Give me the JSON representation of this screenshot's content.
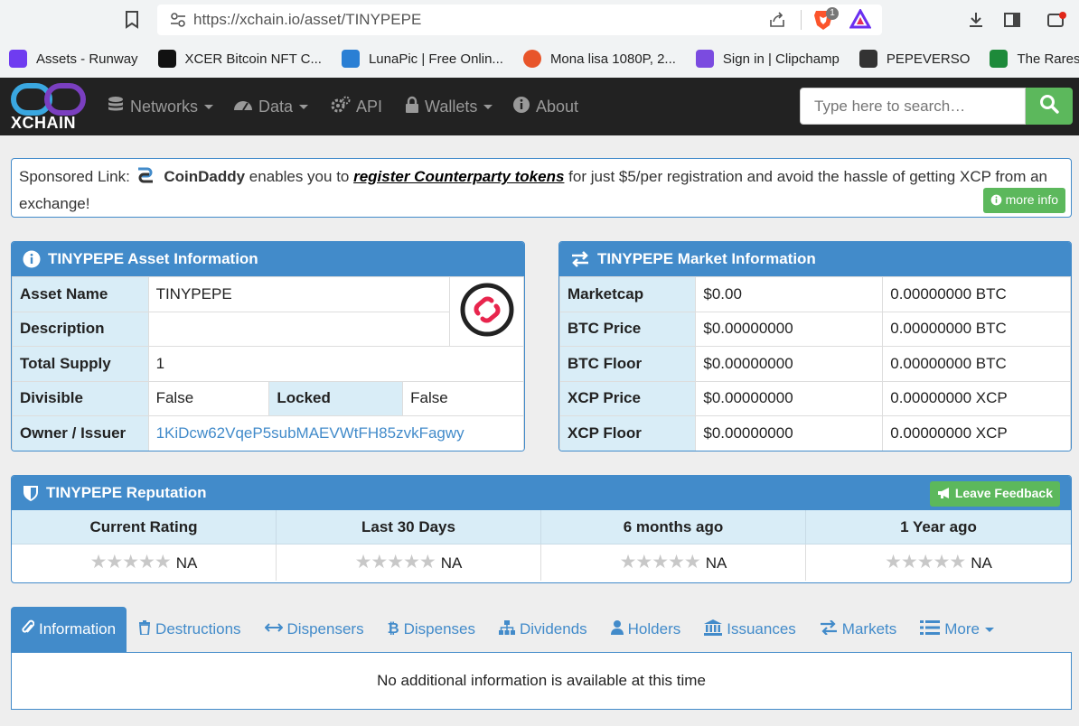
{
  "browser": {
    "url": "https://xchain.io/asset/TINYPEPE",
    "brave_badge": "1",
    "bookmarks": [
      {
        "label": "Assets - Runway",
        "color": "#6f3cf0"
      },
      {
        "label": "XCER Bitcoin NFT C...",
        "color": "#111111"
      },
      {
        "label": "LunaPic | Free Onlin...",
        "color": "#2a7fd4"
      },
      {
        "label": "Mona lisa 1080P, 2...",
        "color": "#e8552a"
      },
      {
        "label": "Sign in | Clipchamp",
        "color": "#7b4be0"
      },
      {
        "label": "PEPEVERSO",
        "color": "#333333"
      },
      {
        "label": "The Rarest Sets – T",
        "color": "#1d8a3a"
      }
    ]
  },
  "navbar": {
    "logo": "XCHAIN",
    "items": [
      {
        "label": "Networks",
        "icon": "database-icon",
        "dropdown": true
      },
      {
        "label": "Data",
        "icon": "dashboard-icon",
        "dropdown": true
      },
      {
        "label": "API",
        "icon": "cogs-icon",
        "dropdown": false
      },
      {
        "label": "Wallets",
        "icon": "lock-icon",
        "dropdown": true
      },
      {
        "label": "About",
        "icon": "info-circle-icon",
        "dropdown": false
      }
    ],
    "search_placeholder": "Type here to search…"
  },
  "sponsored": {
    "prefix": "Sponsored Link: ",
    "brand": "CoinDaddy",
    "mid": " enables you to ",
    "link": "register Counterparty tokens",
    "suffix": " for just $5/per registration and avoid the hassle of getting XCP from an exchange!",
    "more_info": "more info"
  },
  "asset_info": {
    "title": "TINYPEPE Asset Information",
    "asset_name_label": "Asset Name",
    "asset_name": "TINYPEPE",
    "description_label": "Description",
    "description": "",
    "total_supply_label": "Total Supply",
    "total_supply": "1",
    "divisible_label": "Divisible",
    "divisible": "False",
    "locked_label": "Locked",
    "locked": "False",
    "owner_label": "Owner / Issuer",
    "owner": "1KiDcw62VqeP5subMAEVWtFH85zvkFagwy"
  },
  "market_info": {
    "title": "TINYPEPE Market Information",
    "rows": [
      {
        "label": "Marketcap",
        "usd": "$0.00",
        "native": "0.00000000 BTC"
      },
      {
        "label": "BTC Price",
        "usd": "$0.00000000",
        "native": "0.00000000 BTC"
      },
      {
        "label": "BTC Floor",
        "usd": "$0.00000000",
        "native": "0.00000000 BTC"
      },
      {
        "label": "XCP Price",
        "usd": "$0.00000000",
        "native": "0.00000000 XCP"
      },
      {
        "label": "XCP Floor",
        "usd": "$0.00000000",
        "native": "0.00000000 XCP"
      }
    ]
  },
  "reputation": {
    "title": "TINYPEPE Reputation",
    "feedback_label": "Leave Feedback",
    "columns": [
      {
        "header": "Current Rating",
        "value": "NA",
        "stars": 0
      },
      {
        "header": "Last 30 Days",
        "value": "NA",
        "stars": 0
      },
      {
        "header": "6 months ago",
        "value": "NA",
        "stars": 0
      },
      {
        "header": "1 Year ago",
        "value": "NA",
        "stars": 0
      }
    ]
  },
  "tabs": [
    {
      "label": "Information",
      "icon": "paperclip-icon",
      "active": true
    },
    {
      "label": "Destructions",
      "icon": "trash-icon",
      "active": false
    },
    {
      "label": "Dispensers",
      "icon": "arrows-h-icon",
      "active": false
    },
    {
      "label": "Dispenses",
      "icon": "bitcoin-icon",
      "active": false
    },
    {
      "label": "Dividends",
      "icon": "sitemap-icon",
      "active": false
    },
    {
      "label": "Holders",
      "icon": "user-icon",
      "active": false
    },
    {
      "label": "Issuances",
      "icon": "bank-icon",
      "active": false
    },
    {
      "label": "Markets",
      "icon": "exchange-icon",
      "active": false
    },
    {
      "label": "More",
      "icon": "list-icon",
      "active": false,
      "dropdown": true
    }
  ],
  "tab_content": "No additional information is available at this time",
  "colors": {
    "primary": "#428bca",
    "success": "#5cb85c",
    "navbar": "#222222",
    "label_bg": "#d9edf7"
  }
}
